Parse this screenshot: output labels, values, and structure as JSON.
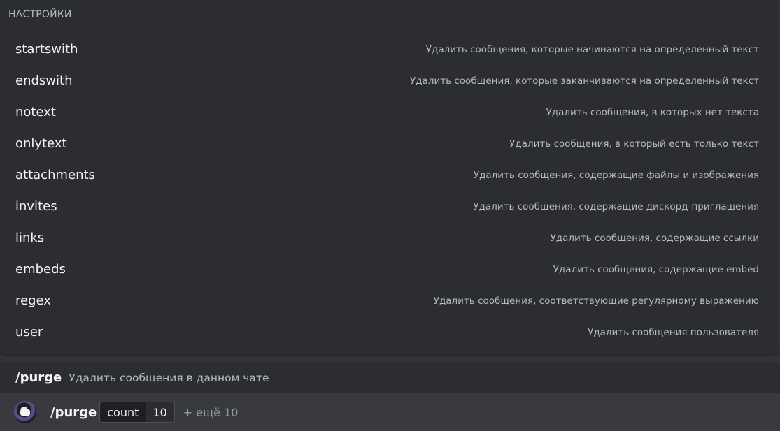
{
  "popup": {
    "section_header": "НАСТРОЙКИ",
    "options": [
      {
        "name": "startswith",
        "description": "Удалить сообщения, которые начинаются на определенный текст"
      },
      {
        "name": "endswith",
        "description": "Удалить сообщения, которые заканчиваются на определенный текст"
      },
      {
        "name": "notext",
        "description": "Удалить сообщения, в которых нет текста"
      },
      {
        "name": "onlytext",
        "description": "Удалить сообщения, в который есть только текст"
      },
      {
        "name": "attachments",
        "description": "Удалить сообщения, содержащие файлы и изображения"
      },
      {
        "name": "invites",
        "description": "Удалить сообщения, содержащие дискорд-приглашения"
      },
      {
        "name": "links",
        "description": "Удалить сообщения, содержащие ссылки"
      },
      {
        "name": "embeds",
        "description": "Удалить сообщения, содержащие embed"
      },
      {
        "name": "regex",
        "description": "Удалить сообщения, соответствующие регулярному выражению"
      },
      {
        "name": "user",
        "description": "Удалить сообщения пользователя"
      }
    ]
  },
  "command_preview": {
    "name": "/purge",
    "description": "Удалить сообщения в данном чате"
  },
  "input": {
    "command": "/purge",
    "param_name": "count",
    "param_value": "10",
    "more": "+ ещё 10"
  }
}
